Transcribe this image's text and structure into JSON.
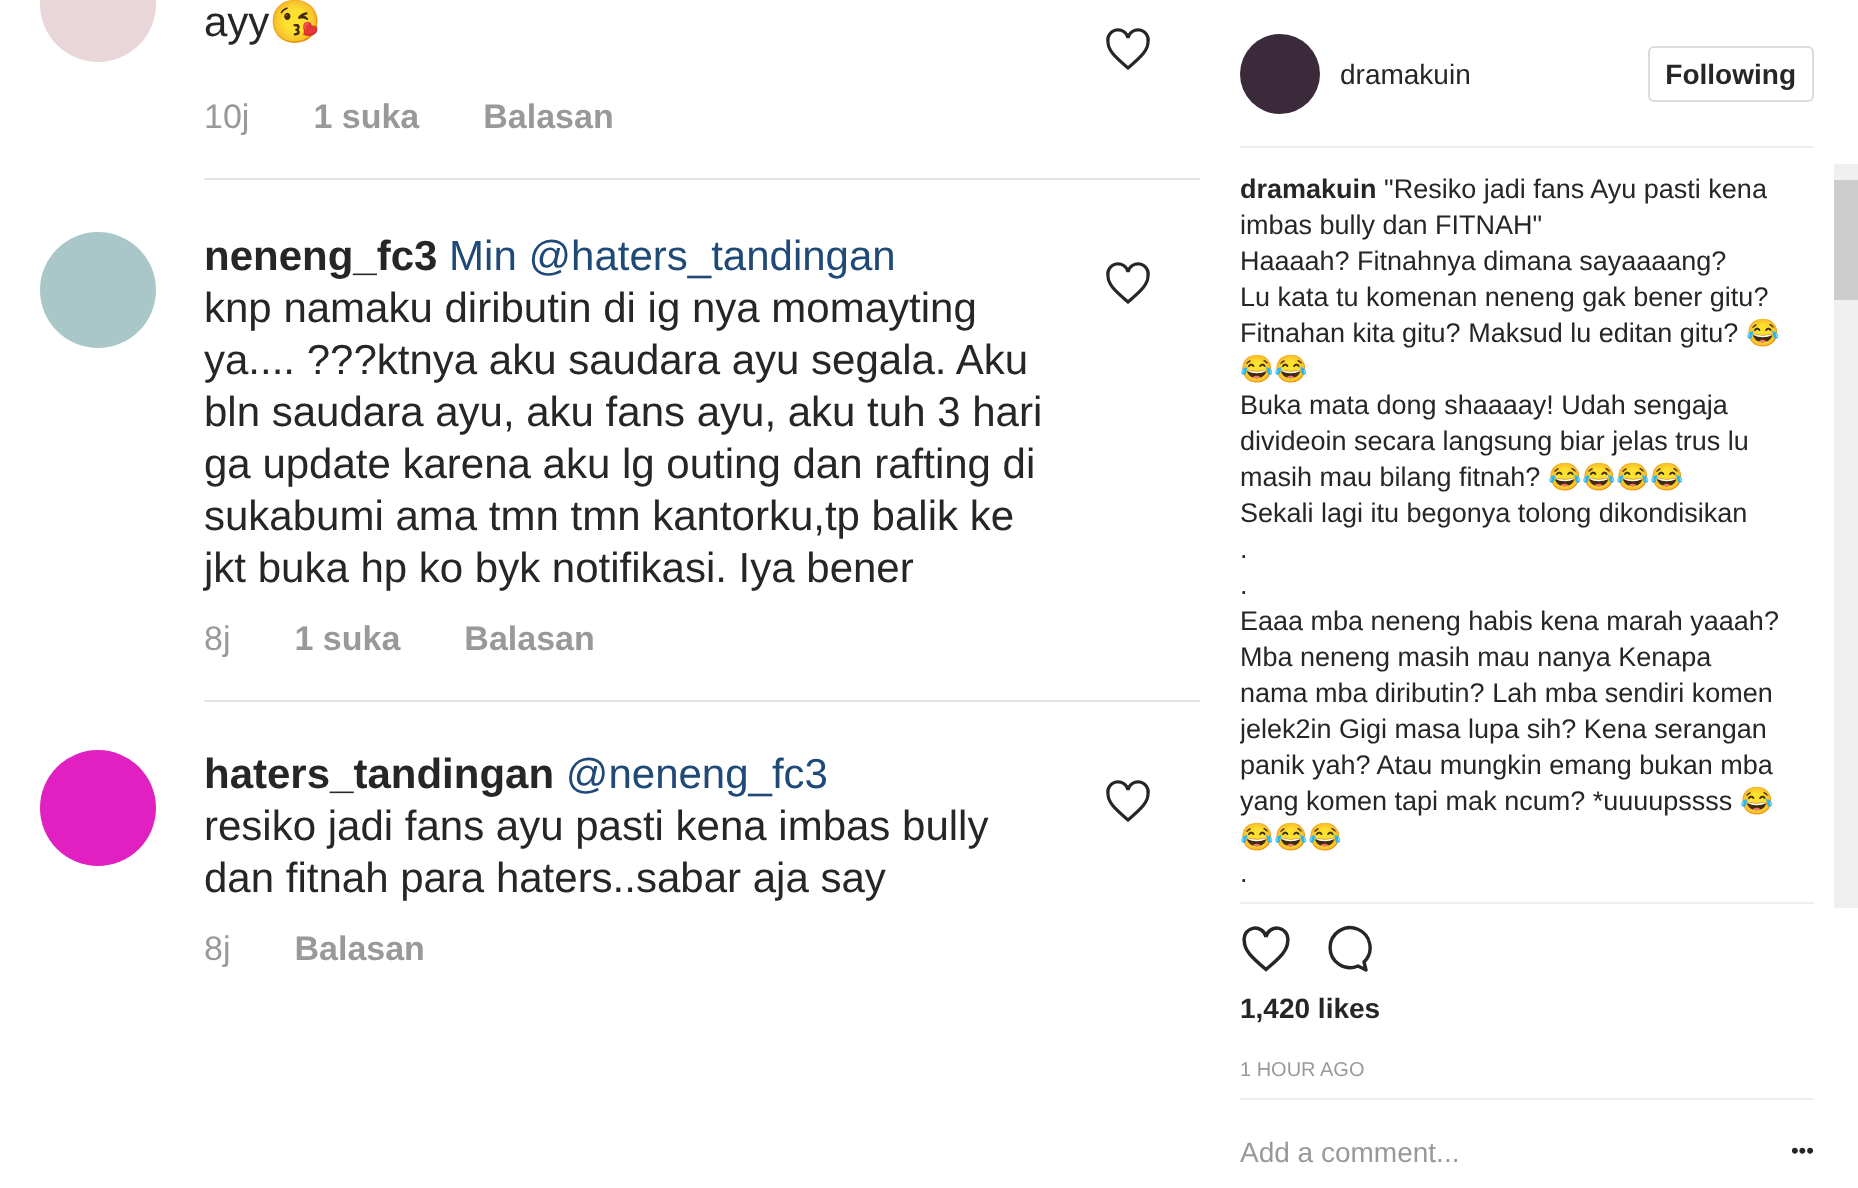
{
  "post_image": {
    "comments": [
      {
        "text": "ayy😘",
        "time": "10j",
        "likes": "1 suka",
        "reply": "Balasan",
        "liked": false
      },
      {
        "username": "neneng_fc3",
        "mention": "Min @haters_tandingan",
        "text": "knp namaku diributin di ig nya momayting ya.... ???ktnya aku saudara ayu segala. Aku bln saudara ayu, aku fans ayu, aku tuh 3 hari ga update karena aku lg outing dan rafting di sukabumi ama tmn tmn kantorku,tp balik ke jkt buka hp ko byk notifikasi. Iya bener",
        "time": "8j",
        "likes": "1 suka",
        "reply": "Balasan",
        "liked": false
      },
      {
        "username": "haters_tandingan",
        "mention": "@neneng_fc3",
        "text": "resiko jadi fans ayu pasti kena imbas bully dan fitnah para haters..sabar aja say",
        "time": "8j",
        "reply": "Balasan",
        "liked": false
      }
    ]
  },
  "sidebar": {
    "username": "dramakuin",
    "follow_button": "Following",
    "caption": {
      "username": "dramakuin",
      "lines": [
        "\"Resiko jadi fans Ayu pasti kena imbas bully dan FITNAH\"",
        "Haaaah? Fitnahnya dimana sayaaaang?",
        "Lu kata tu komenan neneng gak bener gitu? Fitnahan kita gitu? Maksud lu editan gitu? 😂😂😂",
        "Buka mata dong shaaaay! Udah sengaja divideoin secara langsung biar jelas trus lu masih mau bilang fitnah? 😂😂😂😂",
        "Sekali lagi itu begonya tolong dikondisikan",
        ".",
        ".",
        "Eaaa mba neneng habis kena marah yaaah? Mba neneng masih mau nanya Kenapa nama mba diributin? Lah mba sendiri komen jelek2in Gigi masa lupa sih? Kena serangan panik yah? Atau mungkin emang bukan mba yang komen tapi mak ncum? *uuuupssss 😂😂😂😂",
        "."
      ]
    },
    "liked": false,
    "likes": "1,420 likes",
    "time": "1 HOUR AGO",
    "comment_placeholder": "Add a comment...",
    "more": "•••"
  }
}
